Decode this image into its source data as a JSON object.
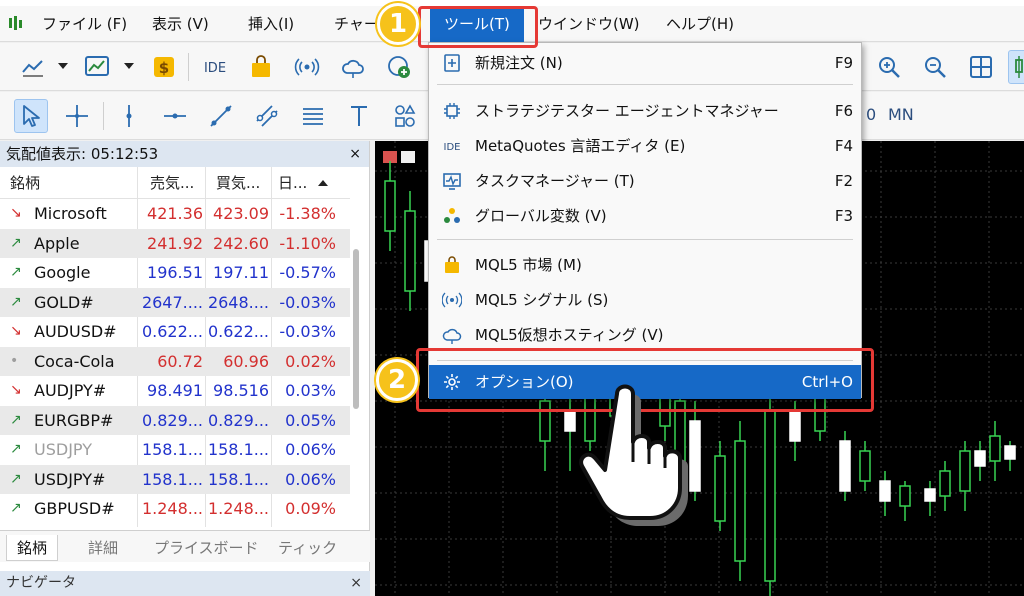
{
  "menubar": {
    "items": [
      "ファイル (F)",
      "表示 (V)",
      "挿入(I)",
      "チャー",
      "ツール(T)",
      "ウインドウ(W)",
      "ヘルプ(H)"
    ]
  },
  "toolbar2": {
    "timeframe_fragment": "0",
    "timeframe_mn": "MN"
  },
  "market_watch": {
    "title": "気配値表示: 05:12:53",
    "close": "×",
    "columns": {
      "symbol": "銘柄",
      "bid": "売気...",
      "ask": "買気...",
      "change": "日..."
    },
    "rows": [
      {
        "symbol": "Microsoft",
        "bid": "421.36",
        "ask": "423.09",
        "change": "-1.38%",
        "dir": "down",
        "color": "red"
      },
      {
        "symbol": "Apple",
        "bid": "241.92",
        "ask": "242.60",
        "change": "-1.10%",
        "dir": "up",
        "color": "red"
      },
      {
        "symbol": "Google",
        "bid": "196.51",
        "ask": "197.11",
        "change": "-0.57%",
        "dir": "up",
        "color": "blue"
      },
      {
        "symbol": "GOLD#",
        "bid": "2647....",
        "ask": "2648....",
        "change": "-0.03%",
        "dir": "up",
        "color": "blue"
      },
      {
        "symbol": "AUDUSD#",
        "bid": "0.622...",
        "ask": "0.622...",
        "change": "-0.03%",
        "dir": "down",
        "color": "blue"
      },
      {
        "symbol": "Coca-Cola",
        "bid": "60.72",
        "ask": "60.96",
        "change": "0.02%",
        "dir": "none",
        "color": "red"
      },
      {
        "symbol": "AUDJPY#",
        "bid": "98.491",
        "ask": "98.516",
        "change": "0.03%",
        "dir": "down",
        "color": "blue"
      },
      {
        "symbol": "EURGBP#",
        "bid": "0.829...",
        "ask": "0.829...",
        "change": "0.05%",
        "dir": "up",
        "color": "blue"
      },
      {
        "symbol": "USDJPY",
        "bid": "158.1...",
        "ask": "158.1...",
        "change": "0.06%",
        "dir": "up",
        "color": "blue",
        "muted": true
      },
      {
        "symbol": "USDJPY#",
        "bid": "158.1...",
        "ask": "158.1...",
        "change": "0.06%",
        "dir": "up",
        "color": "blue"
      },
      {
        "symbol": "GBPUSD#",
        "bid": "1.248...",
        "ask": "1.248...",
        "change": "0.09%",
        "dir": "up",
        "color": "red"
      }
    ],
    "tabs": [
      "銘柄",
      "詳細",
      "プライスボード",
      "ティック"
    ]
  },
  "navigator": {
    "title": "ナビゲータ",
    "close": "×"
  },
  "dropdown": {
    "items": [
      {
        "label": "新規注文 (N)",
        "shortcut": "F9",
        "icon": "new-order-icon"
      },
      {
        "label": "ストラテジテスター エージェントマネジャー",
        "shortcut": "F6",
        "icon": "chip-icon"
      },
      {
        "label": "MetaQuotes 言語エディタ (E)",
        "shortcut": "F4",
        "icon": "ide-icon"
      },
      {
        "label": "タスクマネージャー (T)",
        "shortcut": "F2",
        "icon": "task-manager-icon"
      },
      {
        "label": "グローバル変数 (V)",
        "shortcut": "F3",
        "icon": "global-variables-icon"
      },
      {
        "label": "MQL5 市場 (M)",
        "shortcut": "",
        "icon": "market-bag-icon"
      },
      {
        "label": "MQL5 シグナル (S)",
        "shortcut": "",
        "icon": "signal-icon"
      },
      {
        "label": "MQL5仮想ホスティング (V)",
        "shortcut": "",
        "icon": "cloud-icon"
      },
      {
        "label": "オプション(O)",
        "shortcut": "Ctrl+O",
        "icon": "gear-icon"
      }
    ]
  },
  "callouts": {
    "step1": "1",
    "step2": "2"
  },
  "colors": {
    "accent": "#1669c7",
    "red": "#d32f2f",
    "blue": "#2233cc",
    "badge": "#f6c21b",
    "callout_box": "#e53935"
  }
}
